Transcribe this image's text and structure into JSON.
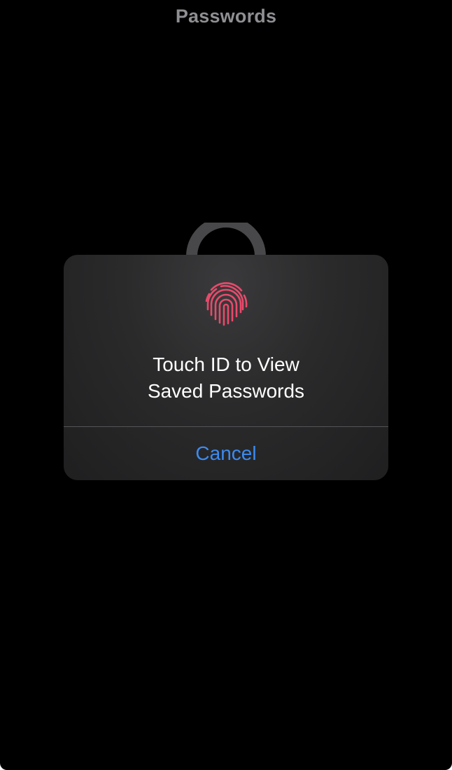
{
  "nav": {
    "title": "Passwords"
  },
  "icons": {
    "background": "lock-icon",
    "dialog": "fingerprint-icon"
  },
  "dialog": {
    "message_line1": "Touch ID to View",
    "message_line2": "Saved Passwords",
    "cancel_label": "Cancel"
  },
  "colors": {
    "background": "#000000",
    "dialog_background": "#2a2a2b",
    "accent": "#3d8bf0",
    "fingerprint": "#e84a6b",
    "nav_title": "#8e8e93"
  }
}
